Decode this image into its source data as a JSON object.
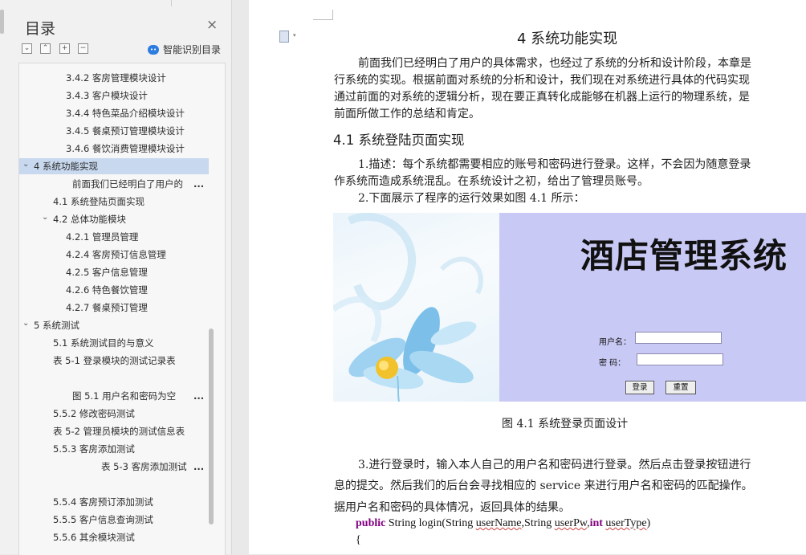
{
  "nav": {
    "title": "目录",
    "close_glyph": "×",
    "smart_label": "智能识别目录",
    "smart_icon": "ai-icon",
    "toolbar_icons": [
      "collapse-all-icon",
      "expand-all-icon",
      "add-heading-icon",
      "remove-heading-icon"
    ],
    "items": [
      {
        "text": "3.4.2  客房管理模块设计",
        "level": 3
      },
      {
        "text": "3.4.3  客户模块设计",
        "level": 3
      },
      {
        "text": "3.4.4  特色菜品介绍模块设计",
        "level": 3
      },
      {
        "text": "3.4.5  餐桌预订管理模块设计",
        "level": 3
      },
      {
        "text": "3.4.6  餐饮消费管理模块设计",
        "level": 3
      },
      {
        "text": "4  系统功能实现",
        "level": 1,
        "expanded": true,
        "selected": true
      },
      {
        "text": "前面我们已经明白了用户的",
        "level": 4,
        "more": "..."
      },
      {
        "text": "4.1 系统登陆页面实现",
        "level": 2
      },
      {
        "text": "4.2 总体功能模块",
        "level": 2,
        "expanded": true
      },
      {
        "text": "4.2.1 管理员管理",
        "level": 3
      },
      {
        "text": "4.2.4 客房预订信息管理",
        "level": 3
      },
      {
        "text": "4.2.5 客户信息管理",
        "level": 3
      },
      {
        "text": "4.2.6 特色餐饮管理",
        "level": 3
      },
      {
        "text": "4.2.7 餐桌预订管理",
        "level": 3
      },
      {
        "text": "5  系统测试",
        "level": 1,
        "expanded": true
      },
      {
        "text": "5.1 系统测试目的与意义",
        "level": 2
      },
      {
        "text": "表 5-1 登录模块的测试记录表",
        "level": 2
      },
      {
        "text": "图 5.1 用户名和密码为空",
        "level": 4,
        "more": "...",
        "spacer": true
      },
      {
        "text": "5.5.2  修改密码测试",
        "level": 2
      },
      {
        "text": "表 5-2 管理员模块的测试信息表",
        "level": 2
      },
      {
        "text": "5.5.3  客房添加测试",
        "level": 2
      },
      {
        "text": "表 5-3 客房添加测试",
        "level": 5,
        "more": "..."
      },
      {
        "text": "5.5.4  客房预订添加测试",
        "level": 2,
        "spacer": true
      },
      {
        "text": "5.5.5 客户信息查询测试",
        "level": 2
      },
      {
        "text": "5.5.6 其余模块测试",
        "level": 2
      }
    ]
  },
  "doc": {
    "chapter_title": "4  系统功能实现",
    "intro_lines": [
      "前面我们已经明白了用户的具体需求，也经过了系统的分析和设计阶段，本章是",
      "行系统的实现。根据前面对系统的分析和设计，我们现在对系统进行具体的代码实现",
      "通过前面的对系统的逻辑分析，现在要正真转化成能够在机器上运行的物理系统，是",
      "前面所做工作的总结和肯定。"
    ],
    "section_title": "4.1 系统登陆页面实现",
    "desc_lines": [
      "1.描述：每个系统都需要相应的账号和密码进行登录。这样，不会因为随意登录",
      "作系统而造成系统混乱。在系统设计之初，给出了管理员账号。",
      "2.下面展示了程序的运行效果如图 4.1 所示："
    ],
    "figure": {
      "banner": "酒店管理系统",
      "username_label": "用户名：",
      "password_label": "密  码：",
      "login_button": "登录",
      "reset_button": "重置"
    },
    "figure_caption": "图 4.1 系统登录页面设计",
    "step3_lines": [
      "3.进行登录时，输入本人自己的用户名和密码进行登录。然后点击登录按钮进行",
      "息的提交。然后我们的后台会寻找相应的 service 来进行用户名和密码的匹配操作。",
      "据用户名和密码的具体情况，返回具体的结果。"
    ],
    "code": {
      "kw_public": "public",
      "sig_a": " String login(String ",
      "p_user": "userName",
      "sig_b": ",String ",
      "p_pw": "userPw",
      "sig_c": ",",
      "kw_int": "int",
      "sig_d": " ",
      "p_type": "userType",
      "sig_e": ")",
      "brace": "{"
    }
  }
}
